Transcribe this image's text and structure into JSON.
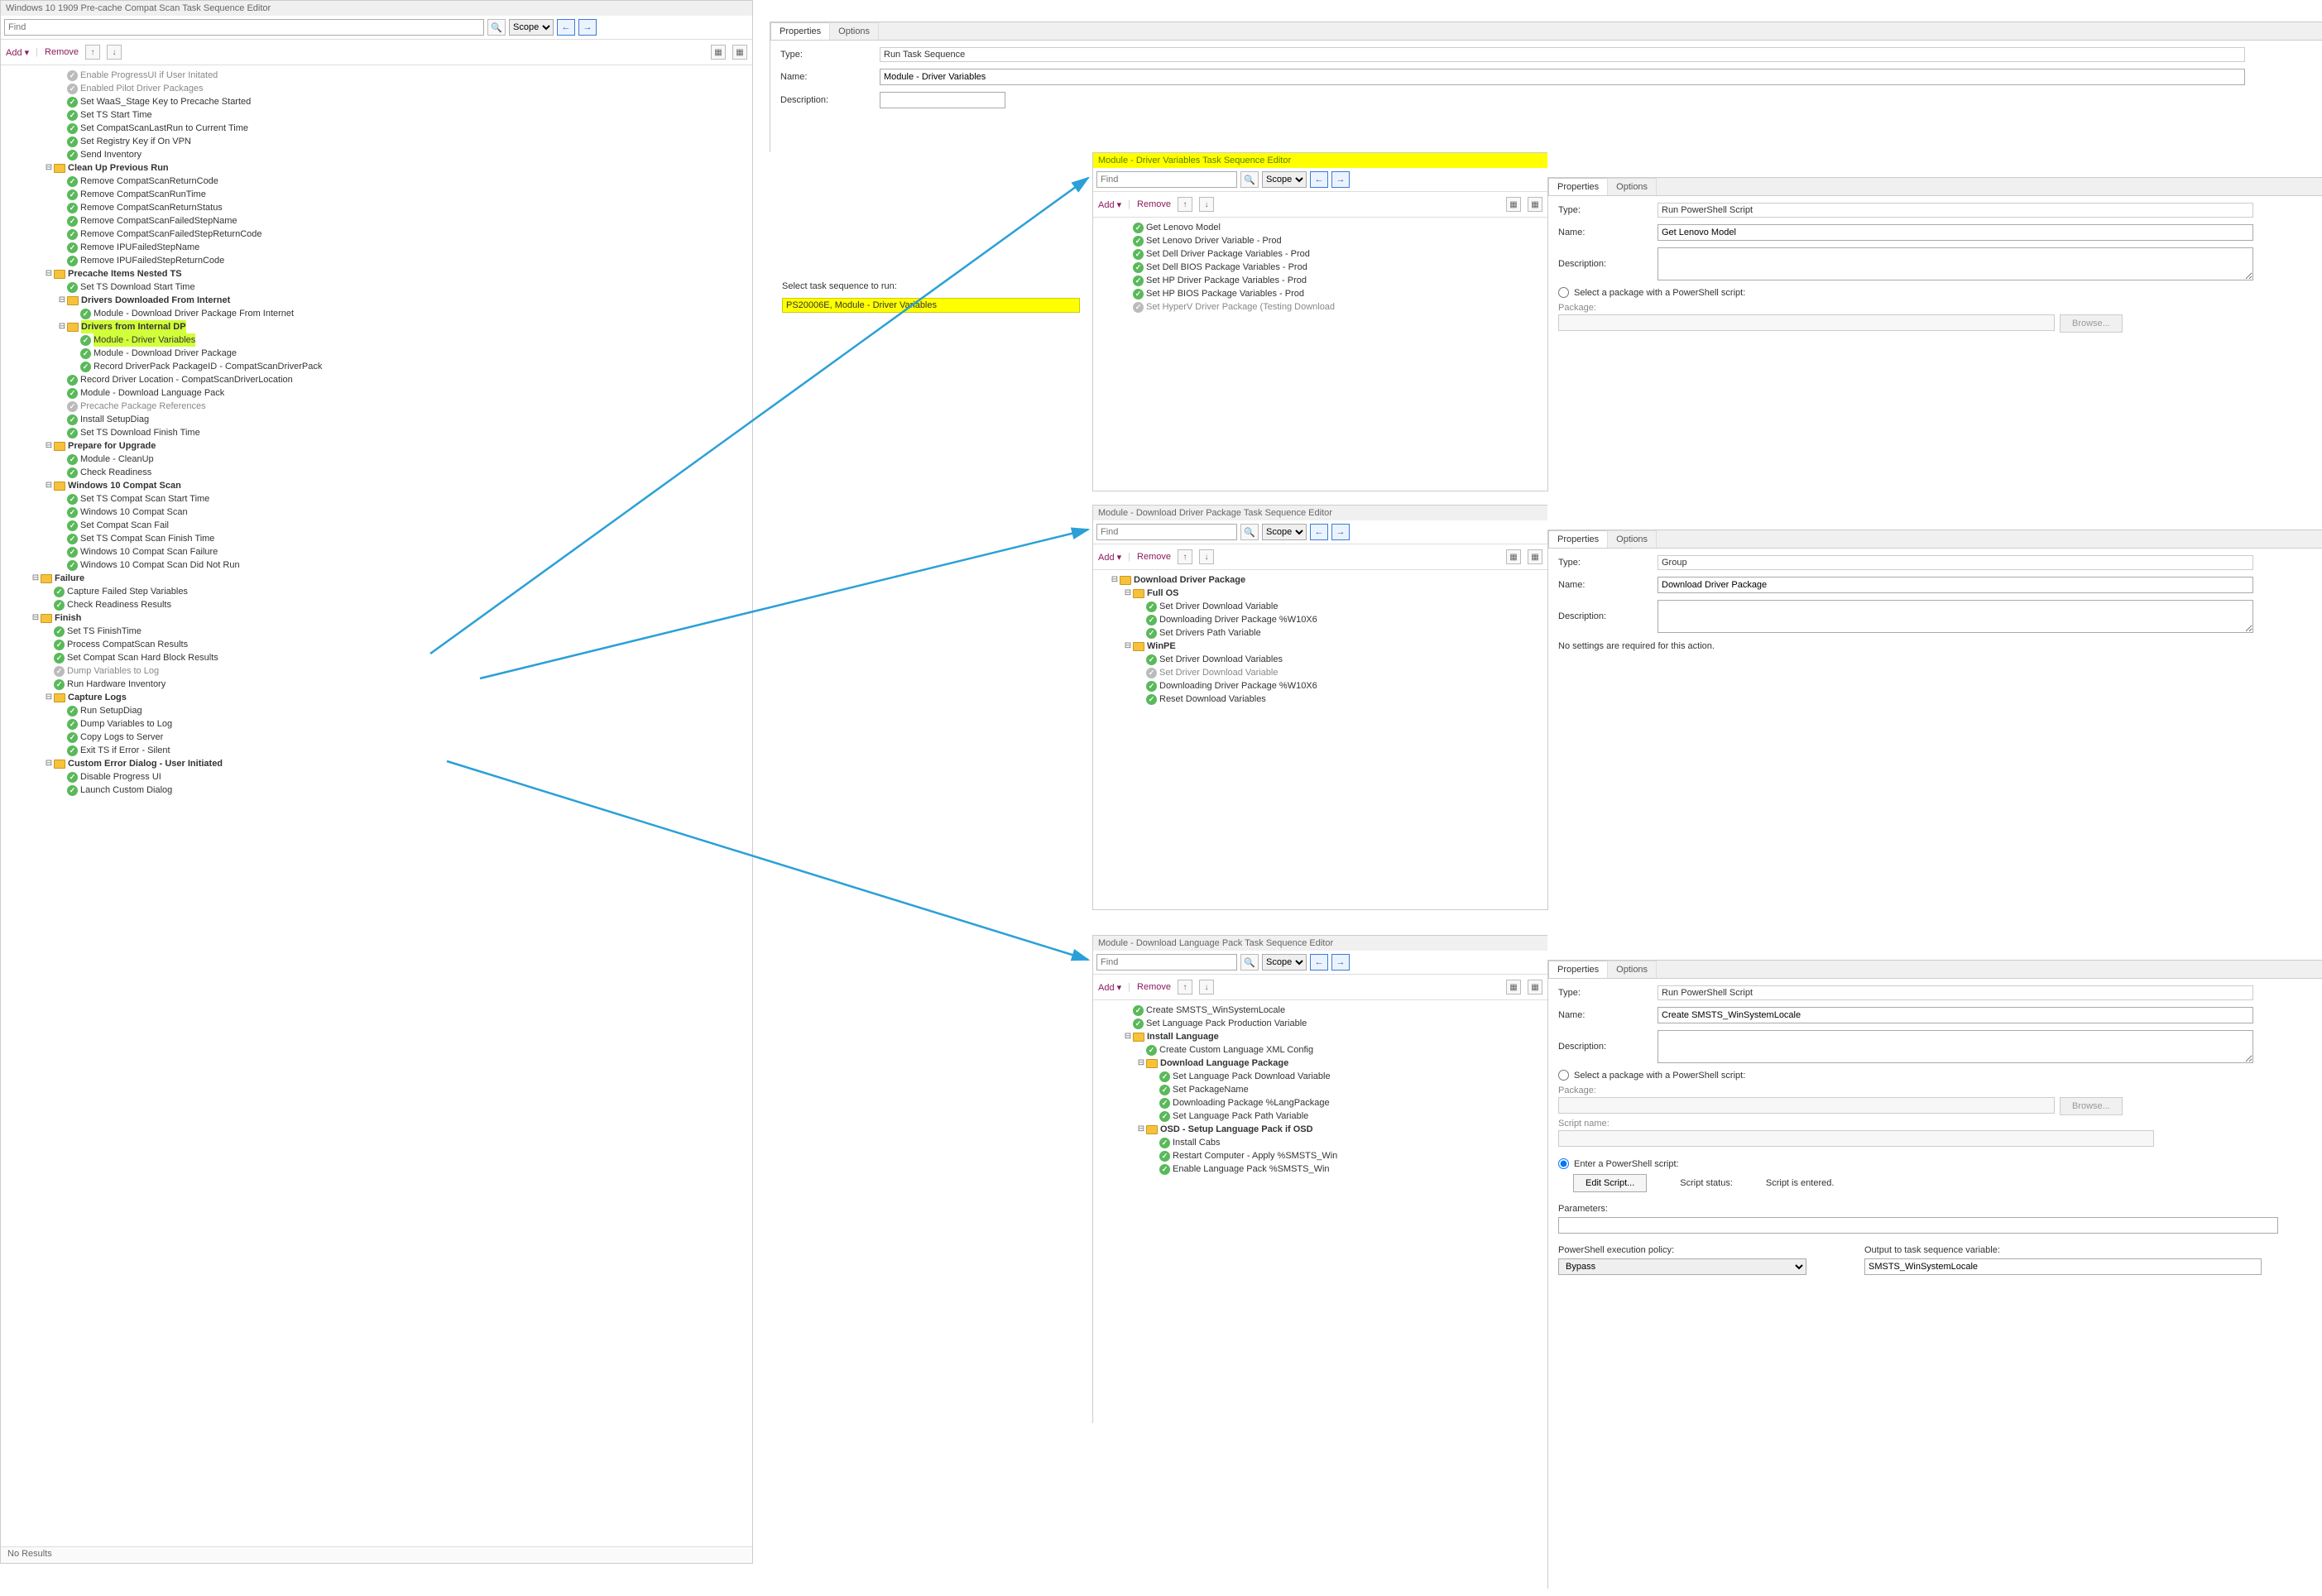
{
  "mainWindow": {
    "title": "Windows 10 1909 Pre-cache Compat Scan Task Sequence Editor",
    "find": "Find",
    "scope": "Scope",
    "add": "Add",
    "remove": "Remove",
    "noResults": "No Results"
  },
  "leftTree": [
    {
      "ind": 4,
      "type": "step",
      "state": "dis",
      "label": "Enable ProgressUI if User Initated"
    },
    {
      "ind": 4,
      "type": "step",
      "state": "dis",
      "label": "Enabled Pilot Driver Packages"
    },
    {
      "ind": 4,
      "type": "step",
      "label": "Set WaaS_Stage Key to Precache Started"
    },
    {
      "ind": 4,
      "type": "step",
      "label": "Set TS Start Time"
    },
    {
      "ind": 4,
      "type": "step",
      "label": "Set CompatScanLastRun to Current Time"
    },
    {
      "ind": 4,
      "type": "step",
      "label": "Set Registry Key if On VPN"
    },
    {
      "ind": 4,
      "type": "step",
      "label": "Send Inventory"
    },
    {
      "ind": 3,
      "type": "folder",
      "tw": "⊟",
      "bold": true,
      "label": "Clean Up Previous Run"
    },
    {
      "ind": 4,
      "type": "step",
      "label": "Remove CompatScanReturnCode"
    },
    {
      "ind": 4,
      "type": "step",
      "label": "Remove CompatScanRunTime"
    },
    {
      "ind": 4,
      "type": "step",
      "label": "Remove CompatScanReturnStatus"
    },
    {
      "ind": 4,
      "type": "step",
      "label": "Remove CompatScanFailedStepName"
    },
    {
      "ind": 4,
      "type": "step",
      "label": "Remove CompatScanFailedStepReturnCode"
    },
    {
      "ind": 4,
      "type": "step",
      "label": "Remove IPUFailedStepName"
    },
    {
      "ind": 4,
      "type": "step",
      "label": "Remove IPUFailedStepReturnCode"
    },
    {
      "ind": 3,
      "type": "folder",
      "tw": "⊟",
      "bold": true,
      "label": "Precache Items Nested TS"
    },
    {
      "ind": 4,
      "type": "step",
      "label": "Set TS Download Start Time"
    },
    {
      "ind": 4,
      "type": "folder",
      "tw": "⊟",
      "bold": true,
      "label": "Drivers Downloaded From Internet"
    },
    {
      "ind": 5,
      "type": "step",
      "label": "Module - Download Driver Package From Internet"
    },
    {
      "ind": 4,
      "type": "folder",
      "tw": "⊟",
      "bold": true,
      "hl": true,
      "label": "Drivers from Internal DP"
    },
    {
      "ind": 5,
      "type": "step",
      "hl": true,
      "label": "Module - Driver Variables"
    },
    {
      "ind": 5,
      "type": "step",
      "label": "Module - Download Driver Package"
    },
    {
      "ind": 5,
      "type": "step",
      "label": "Record DriverPack PackageID - CompatScanDriverPack"
    },
    {
      "ind": 4,
      "type": "step",
      "label": "Record Driver Location - CompatScanDriverLocation"
    },
    {
      "ind": 4,
      "type": "step",
      "label": "Module - Download Language Pack"
    },
    {
      "ind": 4,
      "type": "step",
      "state": "dis",
      "label": "Precache Package References"
    },
    {
      "ind": 4,
      "type": "step",
      "label": "Install SetupDiag"
    },
    {
      "ind": 4,
      "type": "step",
      "label": "Set TS Download Finish Time"
    },
    {
      "ind": 3,
      "type": "folder",
      "tw": "⊟",
      "bold": true,
      "label": "Prepare for Upgrade"
    },
    {
      "ind": 4,
      "type": "step",
      "label": "Module - CleanUp"
    },
    {
      "ind": 4,
      "type": "step",
      "label": "Check Readiness"
    },
    {
      "ind": 3,
      "type": "folder",
      "tw": "⊟",
      "bold": true,
      "label": "Windows 10 Compat Scan"
    },
    {
      "ind": 4,
      "type": "step",
      "label": "Set TS Compat Scan Start Time"
    },
    {
      "ind": 4,
      "type": "step",
      "label": "Windows 10 Compat Scan"
    },
    {
      "ind": 4,
      "type": "step",
      "label": "Set Compat Scan Fail"
    },
    {
      "ind": 4,
      "type": "step",
      "label": "Set TS Compat Scan Finish Time"
    },
    {
      "ind": 4,
      "type": "step",
      "label": "Windows 10 Compat Scan Failure"
    },
    {
      "ind": 4,
      "type": "step",
      "label": "Windows 10 Compat Scan Did Not Run"
    },
    {
      "ind": 2,
      "type": "folder",
      "tw": "⊟",
      "bold": true,
      "label": "Failure"
    },
    {
      "ind": 3,
      "type": "step",
      "label": "Capture Failed Step Variables"
    },
    {
      "ind": 3,
      "type": "step",
      "label": "Check Readiness Results"
    },
    {
      "ind": 2,
      "type": "folder",
      "tw": "⊟",
      "bold": true,
      "label": "Finish"
    },
    {
      "ind": 3,
      "type": "step",
      "label": "Set TS FinishTime"
    },
    {
      "ind": 3,
      "type": "step",
      "label": "Process CompatScan Results"
    },
    {
      "ind": 3,
      "type": "step",
      "label": "Set Compat Scan Hard Block Results"
    },
    {
      "ind": 3,
      "type": "step",
      "state": "dis",
      "label": "Dump Variables to Log"
    },
    {
      "ind": 3,
      "type": "step",
      "label": "Run Hardware Inventory"
    },
    {
      "ind": 3,
      "type": "folder",
      "tw": "⊟",
      "bold": true,
      "label": "Capture Logs"
    },
    {
      "ind": 4,
      "type": "step",
      "label": "Run SetupDiag"
    },
    {
      "ind": 4,
      "type": "step",
      "label": "Dump Variables to Log"
    },
    {
      "ind": 4,
      "type": "step",
      "label": "Copy Logs to Server"
    },
    {
      "ind": 4,
      "type": "step",
      "label": "Exit TS if Error - Silent"
    },
    {
      "ind": 3,
      "type": "folder",
      "tw": "⊟",
      "bold": true,
      "label": "Custom Error Dialog - User Initiated"
    },
    {
      "ind": 4,
      "type": "step",
      "label": "Disable Progress UI"
    },
    {
      "ind": 4,
      "type": "step",
      "label": "Launch Custom Dialog"
    }
  ],
  "mainProps": {
    "tabProperties": "Properties",
    "tabOptions": "Options",
    "typeLabel": "Type:",
    "typeValue": "Run Task Sequence",
    "nameLabel": "Name:",
    "nameValue": "Module - Driver Variables",
    "descLabel": "Description:",
    "selectLabel": "Select task sequence to run:",
    "selectedTS": "PS20006E, Module - Driver Variables"
  },
  "editorB": {
    "title": "Module - Driver Variables Task Sequence Editor",
    "find": "Find",
    "scope": "Scope",
    "add": "Add",
    "remove": "Remove",
    "tree": [
      {
        "ind": 2,
        "type": "step",
        "label": "Get Lenovo Model"
      },
      {
        "ind": 2,
        "type": "step",
        "label": "Set Lenovo Driver Variable - Prod"
      },
      {
        "ind": 2,
        "type": "step",
        "label": "Set Dell Driver Package Variables - Prod"
      },
      {
        "ind": 2,
        "type": "step",
        "label": "Set Dell BIOS Package Variables - Prod"
      },
      {
        "ind": 2,
        "type": "step",
        "label": "Set HP Driver Package Variables - Prod"
      },
      {
        "ind": 2,
        "type": "step",
        "label": "Set HP BIOS Package Variables - Prod"
      },
      {
        "ind": 2,
        "type": "step",
        "state": "dis",
        "label": "Set HyperV Driver Package (Testing Download"
      }
    ],
    "props": {
      "typeLabel": "Type:",
      "typeValue": "Run PowerShell Script",
      "nameLabel": "Name:",
      "nameValue": "Get Lenovo Model",
      "descLabel": "Description:",
      "radioLabel": "Select a package with a PowerShell script:",
      "packageLabel": "Package:",
      "browse": "Browse..."
    }
  },
  "editorC": {
    "title": "Module - Download Driver Package Task Sequence Editor",
    "find": "Find",
    "scope": "Scope",
    "add": "Add",
    "remove": "Remove",
    "tree": [
      {
        "ind": 1,
        "type": "folder",
        "tw": "⊟",
        "bold": true,
        "label": "Download Driver Package"
      },
      {
        "ind": 2,
        "type": "folder",
        "tw": "⊟",
        "bold": true,
        "label": "Full OS"
      },
      {
        "ind": 3,
        "type": "step",
        "label": "Set Driver Download Variable"
      },
      {
        "ind": 3,
        "type": "step",
        "label": "Downloading Driver Package %W10X6"
      },
      {
        "ind": 3,
        "type": "step",
        "label": "Set Drivers Path Variable"
      },
      {
        "ind": 2,
        "type": "folder",
        "tw": "⊟",
        "bold": true,
        "label": "WinPE"
      },
      {
        "ind": 3,
        "type": "step",
        "label": "Set Driver Download Variables"
      },
      {
        "ind": 3,
        "type": "step",
        "state": "dis",
        "label": "Set Driver Download Variable"
      },
      {
        "ind": 3,
        "type": "step",
        "label": "Downloading Driver Package %W10X6"
      },
      {
        "ind": 3,
        "type": "step",
        "label": "Reset Download Variables"
      }
    ],
    "props": {
      "typeLabel": "Type:",
      "typeValue": "Group",
      "nameLabel": "Name:",
      "nameValue": "Download Driver Package",
      "descLabel": "Description:",
      "noSettings": "No settings are required for this action."
    }
  },
  "editorD": {
    "title": "Module - Download Language Pack Task Sequence Editor",
    "find": "Find",
    "scope": "Scope",
    "add": "Add",
    "remove": "Remove",
    "tree": [
      {
        "ind": 2,
        "type": "step",
        "label": "Create SMSTS_WinSystemLocale"
      },
      {
        "ind": 2,
        "type": "step",
        "label": "Set Language Pack Production Variable"
      },
      {
        "ind": 2,
        "type": "folder",
        "tw": "⊟",
        "bold": true,
        "label": "Install Language"
      },
      {
        "ind": 3,
        "type": "step",
        "label": "Create Custom Language XML Config"
      },
      {
        "ind": 3,
        "type": "folder",
        "tw": "⊟",
        "bold": true,
        "label": "Download Language Package"
      },
      {
        "ind": 4,
        "type": "step",
        "label": "Set Language Pack Download Variable"
      },
      {
        "ind": 4,
        "type": "step",
        "label": "Set PackageName"
      },
      {
        "ind": 4,
        "type": "step",
        "label": "Downloading Package %LangPackage"
      },
      {
        "ind": 4,
        "type": "step",
        "label": "Set Language Pack Path Variable"
      },
      {
        "ind": 3,
        "type": "folder",
        "tw": "⊟",
        "bold": true,
        "label": "OSD - Setup Language Pack if OSD"
      },
      {
        "ind": 4,
        "type": "step",
        "label": "Install Cabs"
      },
      {
        "ind": 4,
        "type": "step",
        "label": "Restart Computer - Apply %SMSTS_Win"
      },
      {
        "ind": 4,
        "type": "step",
        "label": "Enable Language Pack %SMSTS_Win"
      }
    ],
    "props": {
      "typeLabel": "Type:",
      "typeValue": "Run PowerShell Script",
      "nameLabel": "Name:",
      "nameValue": "Create SMSTS_WinSystemLocale",
      "descLabel": "Description:",
      "radio1": "Select a package with a PowerShell script:",
      "packageLabel": "Package:",
      "browse": "Browse...",
      "scriptNameLabel": "Script name:",
      "radio2": "Enter a PowerShell script:",
      "editScript": "Edit Script...",
      "scriptStatusLabel": "Script status:",
      "scriptStatusValue": "Script is entered.",
      "paramsLabel": "Parameters:",
      "policyLabel": "PowerShell execution policy:",
      "policyValue": "Bypass",
      "outputLabel": "Output to task sequence variable:",
      "outputValue": "SMSTS_WinSystemLocale"
    }
  },
  "tabs": {
    "properties": "Properties",
    "options": "Options"
  }
}
